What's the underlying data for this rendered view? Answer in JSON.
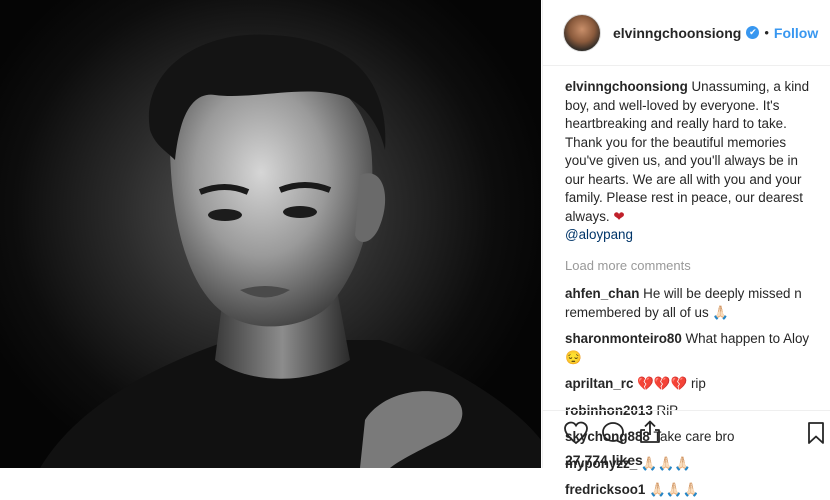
{
  "post": {
    "username": "elvinngchoonsiong",
    "verified_mark": "✔",
    "separator": "•",
    "follow_label": "Follow"
  },
  "caption": {
    "username": "elvinngchoonsiong",
    "text": " Unassuming, a kind boy, and well-loved by everyone. It's heartbreaking and really hard to take. Thank you for the beautiful memories you've given us, and you'll always be in our hearts. We are all with you and your family. Please rest in peace, our dearest always. ",
    "heart": "❤",
    "mention": "@aloypang"
  },
  "load_more_label": "Load more comments",
  "comments": [
    {
      "user": "ahfen_chan",
      "text": " He will be deeply missed n remembered by all of us 🙏🏻"
    },
    {
      "user": "sharonmonteiro80",
      "text": " What happen to Aloy😔"
    },
    {
      "user": "apriltan_rc",
      "text": " 💔💔💔 rip"
    },
    {
      "user": "robinhon2013",
      "text": " RiP"
    },
    {
      "user": "skychong888",
      "text": " Take care bro"
    },
    {
      "user": "myponyzz_",
      "text": " 🙏🏻🙏🏻🙏🏻"
    },
    {
      "user": "fredricksoo1",
      "text": " 🙏🏻🙏🏻🙏🏻"
    }
  ],
  "likes": "27,774 likes",
  "icons": [
    "heart-icon",
    "comment-icon",
    "share-icon",
    "bookmark-icon"
  ],
  "colors": {
    "accent": "#3897f0",
    "heart": "#c0202a"
  }
}
